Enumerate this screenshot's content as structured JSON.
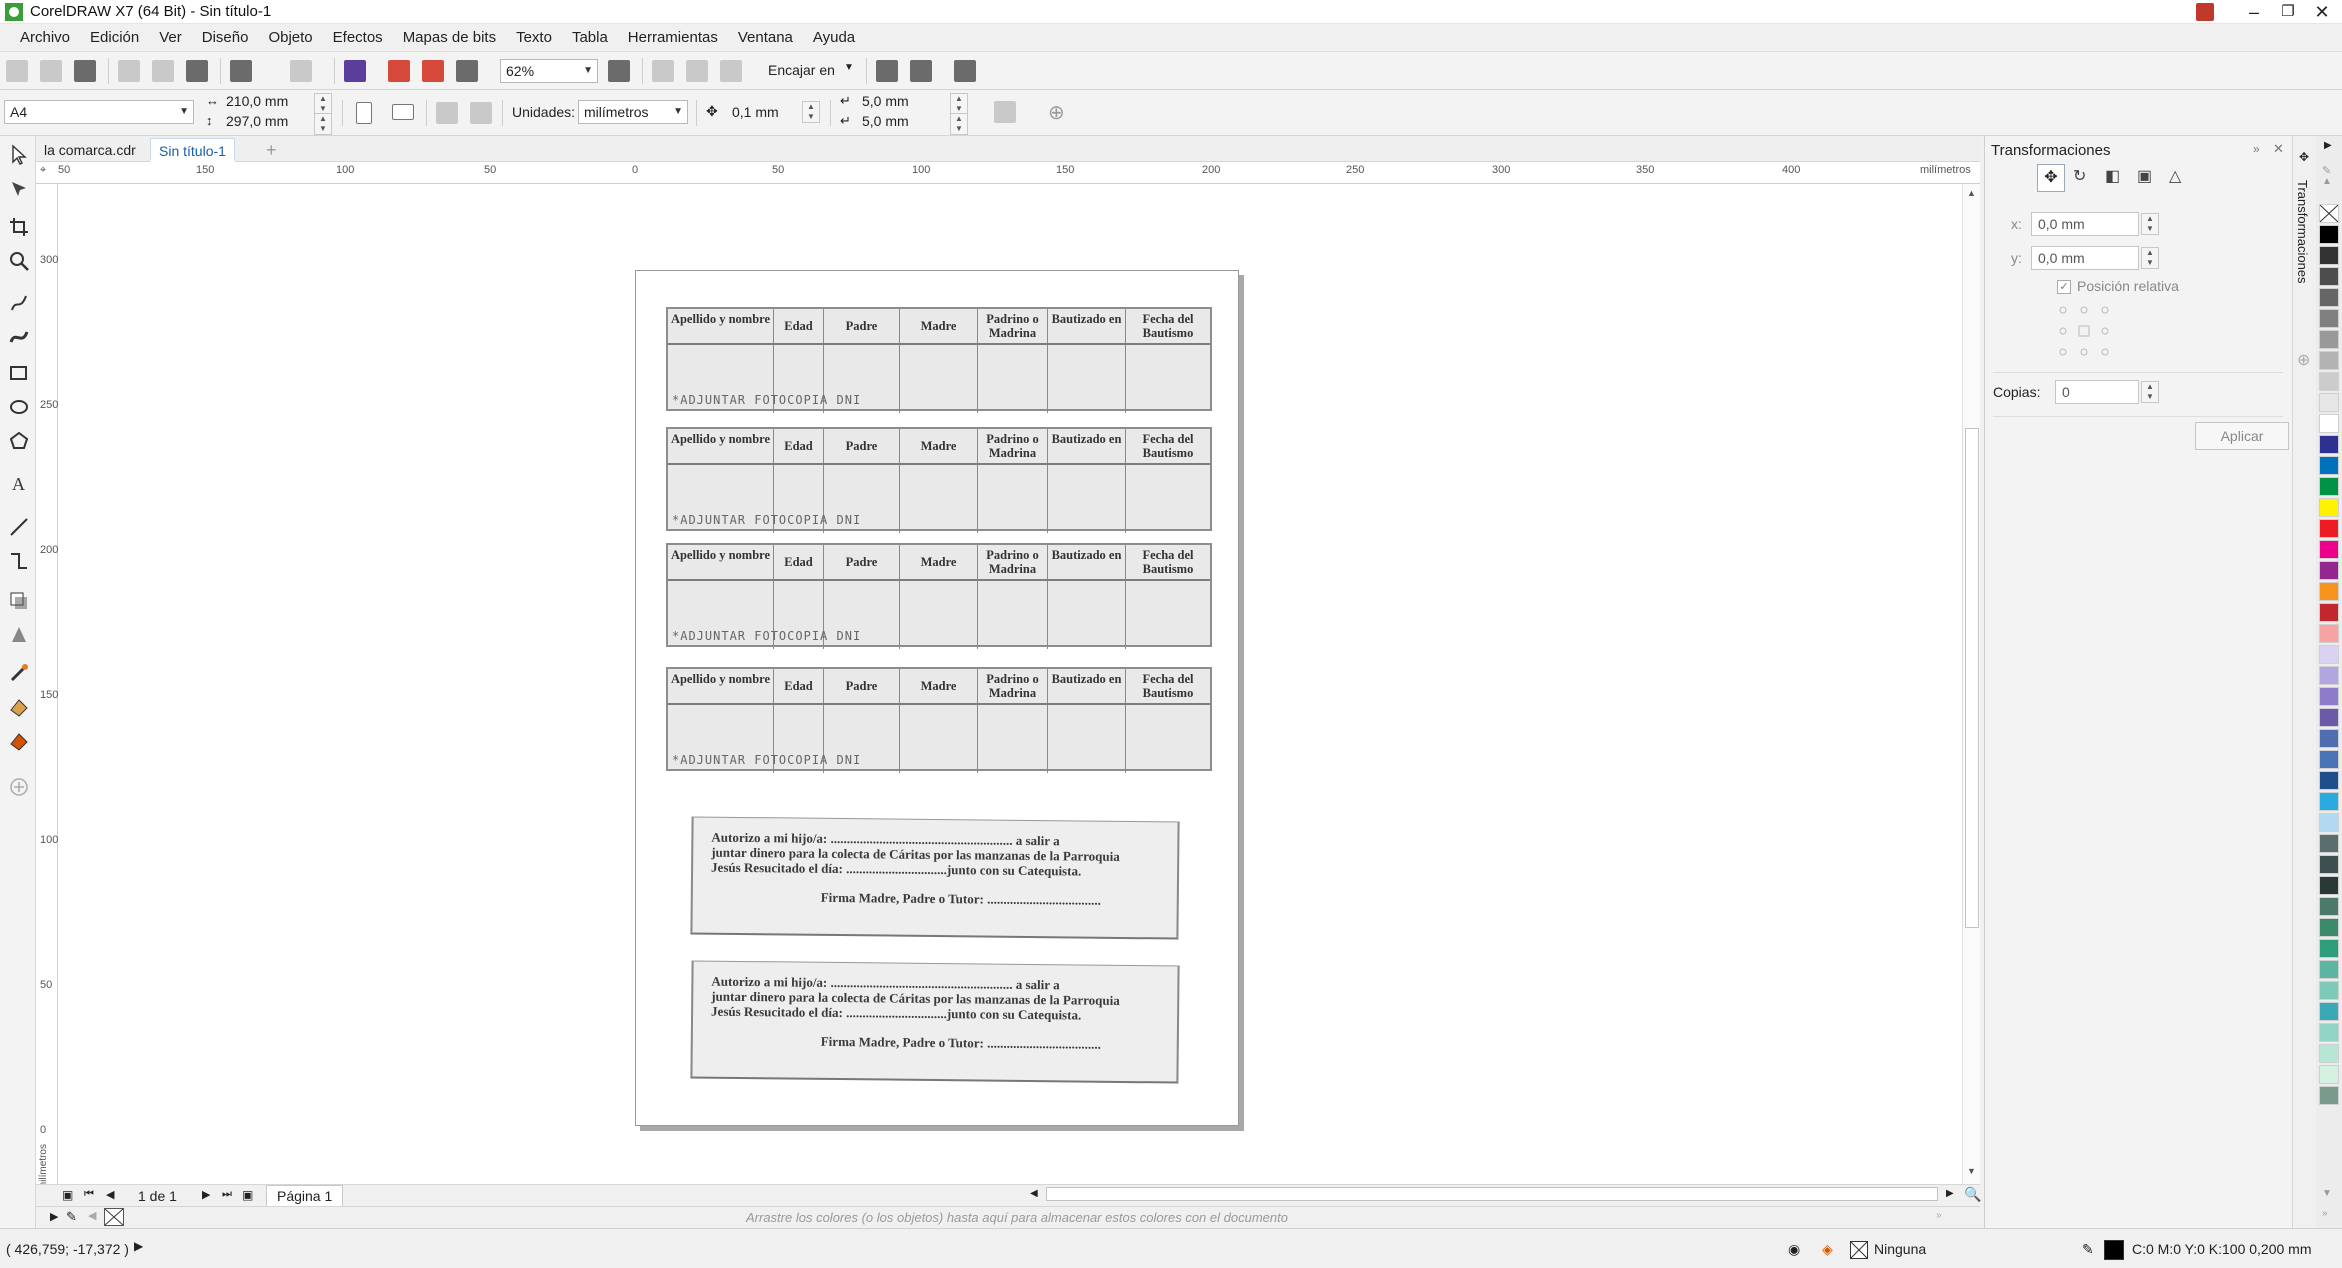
{
  "window": {
    "title": "CorelDRAW X7 (64 Bit) - Sin título-1",
    "controls": [
      "minimize-icon",
      "restore-icon",
      "close-icon"
    ]
  },
  "menubar": {
    "items": [
      "Archivo",
      "Edición",
      "Ver",
      "Diseño",
      "Objeto",
      "Efectos",
      "Mapas de bits",
      "Texto",
      "Tabla",
      "Herramientas",
      "Ventana",
      "Ayuda"
    ]
  },
  "toolbar": {
    "zoom_value": "62%",
    "snap_label": "Encajar en"
  },
  "property_bar": {
    "page_size": "A4",
    "width": "210,0 mm",
    "height": "297,0 mm",
    "units_label": "Unidades:",
    "units_value": "milímetros",
    "nudge": "0,1 mm",
    "dup_x": "5,0 mm",
    "dup_y": "5,0 mm"
  },
  "doc_tabs": [
    {
      "label": "la comarca.cdr",
      "active": false
    },
    {
      "label": "Sin título-1",
      "active": true
    }
  ],
  "ruler": {
    "unit": "milímetros",
    "h_ticks": [
      "50",
      "150",
      "100",
      "50",
      "0",
      "50",
      "100",
      "150",
      "200",
      "250",
      "300",
      "350",
      "400"
    ],
    "v_ticks": [
      "300",
      "250",
      "200",
      "150",
      "100",
      "50",
      "0"
    ],
    "v_unit": "milímetros"
  },
  "document": {
    "tables": [
      {
        "note": "*ADJUNTAR FOTOCOPIA DNI"
      },
      {
        "note": "*ADJUNTAR FOTOCOPIA DNI"
      },
      {
        "note": "*ADJUNTAR FOTOCOPIA DNI"
      },
      {
        "note": "*ADJUNTAR FOTOCOPIA DNI"
      }
    ],
    "table_headers": [
      "Apellido y nombre",
      "Edad",
      "Padre",
      "Madre",
      "Padrino o Madrina",
      "Bautizado en",
      "Fecha del Bautismo"
    ],
    "auth_line1": "Autorizo a mi hijo/a: ........................................................ a salir a",
    "auth_line2": "juntar dinero para la colecta de Cáritas por las manzanas de la Parroquia",
    "auth_line3": "Jesús Resucitado el día: ...............................junto con su Catequista.",
    "auth_sign": "Firma Madre, Padre o Tutor: ..................................."
  },
  "page_nav": {
    "counter": "1 de 1",
    "page_tab": "Página 1"
  },
  "color_docker_hint": "Arrastre los colores (o los objetos) hasta aquí para almacenar estos colores con el documento",
  "status": {
    "coords": "( 426,759; -17,372 )",
    "fill_label": "Ninguna",
    "outline_info": "C:0 M:0 Y:0 K:100  0,200 mm"
  },
  "docker": {
    "title": "Transformaciones",
    "tab_label": "Transformaciones",
    "x_label": "x:",
    "x_value": "0,0 mm",
    "y_label": "y:",
    "y_value": "0,0 mm",
    "relative_label": "Posición relativa",
    "copies_label": "Copias:",
    "copies_value": "0",
    "apply_label": "Aplicar"
  },
  "palette": {
    "colors": [
      "#ffffff",
      "#000000",
      "#333333",
      "#4d4d4d",
      "#666666",
      "#808080",
      "#999999",
      "#b3b3b3",
      "#cccccc",
      "#e6e6e6",
      "#ffffff",
      "#2e3192",
      "#0071bc",
      "#009245",
      "#fff200",
      "#ed1c24",
      "#ec008c",
      "#92278f",
      "#f7941d",
      "#c1272d",
      "#f5a3a3",
      "#d9d2f0",
      "#b3a6e0",
      "#8c7cc9",
      "#6a5aa8",
      "#4f6db0",
      "#4a73b5",
      "#1f4e8a",
      "#29abe2",
      "#b3d9f2",
      "#5a6e6e",
      "#3d4f4f",
      "#2b3838",
      "#4c7a6a",
      "#3b8a6a",
      "#2e9e7a",
      "#5bb5a0",
      "#7fc9b8",
      "#3aa8b5",
      "#8fd4c4",
      "#b8e6d4",
      "#d4f0e0",
      "#7a9a8a"
    ]
  }
}
